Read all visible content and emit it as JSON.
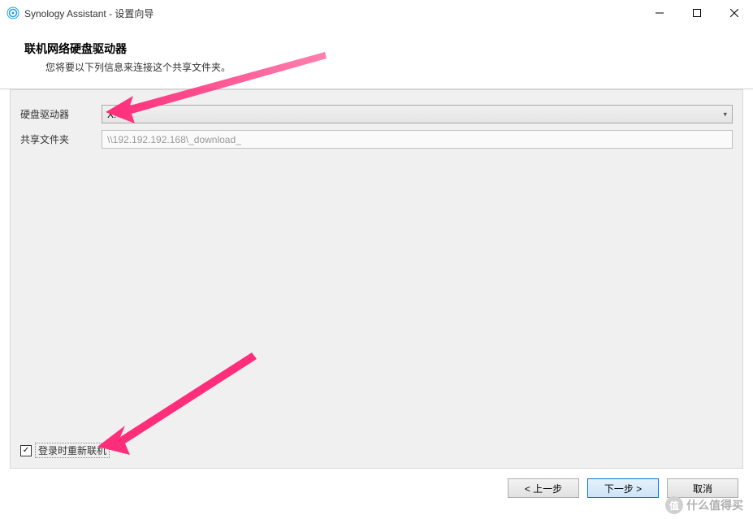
{
  "titlebar": {
    "app_name": "Synology Assistant",
    "wizard_suffix": " - 设置向导"
  },
  "header": {
    "title": "联机网络硬盘驱动器",
    "subtitle": "您将要以下列信息来连接这个共享文件夹。"
  },
  "form": {
    "drive_label": "硬盘驱动器",
    "drive_value": "X:",
    "folder_label": "共享文件夹",
    "folder_value": "\\\\192.192.192.168\\_download_"
  },
  "checkbox": {
    "checked": "✓",
    "label": "登录时重新联机"
  },
  "buttons": {
    "back": "< 上一步",
    "next": "下一步 >",
    "cancel": "取消"
  },
  "watermark": {
    "text": "什么值得买",
    "icon": "值"
  }
}
